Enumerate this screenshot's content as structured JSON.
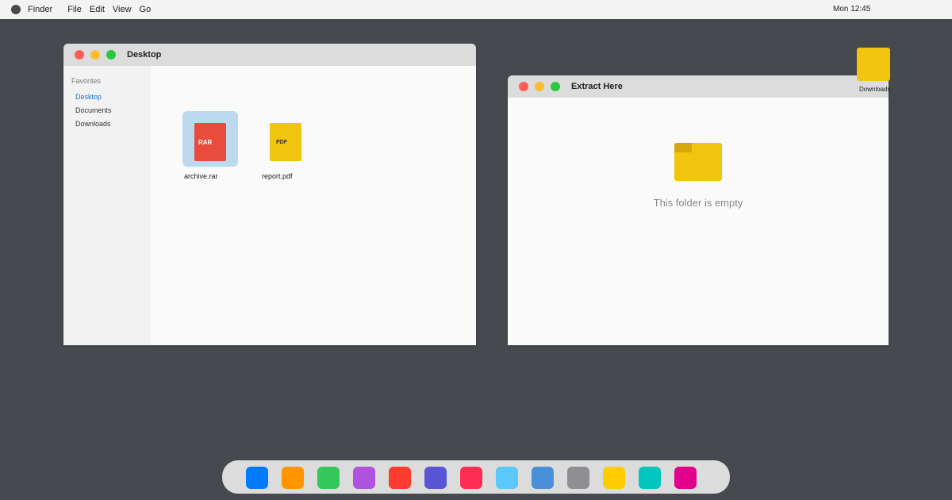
{
  "menubar": {
    "app_name": "Finder",
    "menus": [
      "File",
      "Edit",
      "View",
      "Go"
    ],
    "clock": "Mon 12:45"
  },
  "desktop_window": {
    "title": "Desktop",
    "sidebar": {
      "heading": "Favorites",
      "items": [
        {
          "label": "Desktop",
          "active": true
        },
        {
          "label": "Documents",
          "active": false
        },
        {
          "label": "Downloads",
          "active": false
        }
      ]
    },
    "files": [
      {
        "name": "archive.rar",
        "badge": "RAR",
        "selected": true,
        "color": "#e74c3c"
      },
      {
        "name": "report.pdf",
        "badge": "PDF",
        "selected": false,
        "color": "#f1c40f"
      }
    ]
  },
  "extract_window": {
    "title": "Extract Here",
    "empty_message": "This folder is empty"
  },
  "desktop_icons": [
    {
      "label": "Downloads",
      "icon": "folder-icon",
      "color": "#f1c40f"
    }
  ],
  "dock": {
    "apps": [
      {
        "icon": "app-icon-blue",
        "color": "#007aff"
      },
      {
        "icon": "app-icon-orange",
        "color": "#ff9500"
      },
      {
        "icon": "app-icon-green",
        "color": "#34c759"
      },
      {
        "icon": "app-icon-purple",
        "color": "#af52de"
      },
      {
        "icon": "app-icon-red",
        "color": "#ff3b30"
      },
      {
        "icon": "app-icon-indigo",
        "color": "#5856d6"
      },
      {
        "icon": "app-icon-pink",
        "color": "#ff2d55"
      },
      {
        "icon": "app-icon-lightblue",
        "color": "#5ac8fa"
      },
      {
        "icon": "app-icon-steelblue",
        "color": "#4a90d9"
      },
      {
        "icon": "app-icon-gray",
        "color": "#8e8e93"
      },
      {
        "icon": "app-icon-yellow",
        "color": "#ffcc00"
      },
      {
        "icon": "app-icon-teal",
        "color": "#00c7be"
      },
      {
        "icon": "app-icon-magenta",
        "color": "#e3008c"
      }
    ]
  }
}
